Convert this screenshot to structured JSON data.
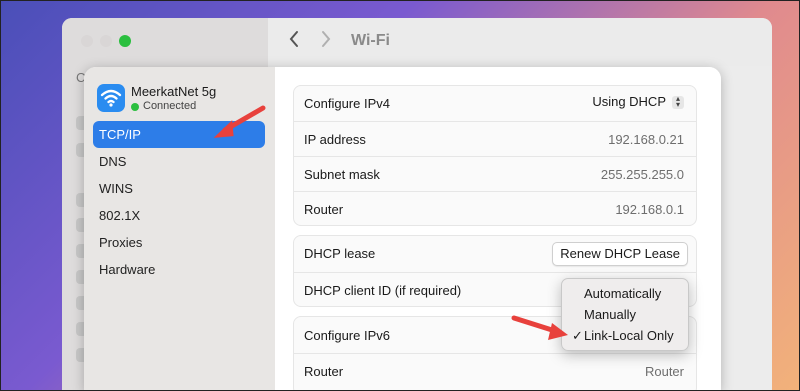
{
  "window": {
    "title": "Wi-Fi",
    "back_icon": "chevron-left-icon",
    "forward_icon": "chevron-right-icon"
  },
  "background_sidebar": {
    "partial_text": "C"
  },
  "network": {
    "name": "MeerkatNet 5g",
    "status": "Connected",
    "icon": "wifi-icon"
  },
  "sidebar": {
    "items": [
      {
        "label": "TCP/IP",
        "selected": true
      },
      {
        "label": "DNS"
      },
      {
        "label": "WINS"
      },
      {
        "label": "802.1X"
      },
      {
        "label": "Proxies"
      },
      {
        "label": "Hardware"
      }
    ]
  },
  "ipv4": {
    "configure_label": "Configure IPv4",
    "configure_value": "Using DHCP",
    "ip_label": "IP address",
    "ip_value": "192.168.0.21",
    "subnet_label": "Subnet mask",
    "subnet_value": "255.255.255.0",
    "router_label": "Router",
    "router_value": "192.168.0.1"
  },
  "dhcp": {
    "lease_label": "DHCP lease",
    "renew_button": "Renew DHCP Lease",
    "client_id_label": "DHCP client ID (if required)"
  },
  "ipv6": {
    "configure_label": "Configure IPv6",
    "router_label": "Router",
    "router_value": "Router"
  },
  "ipv6_menu": {
    "options": [
      "Automatically",
      "Manually",
      "Link-Local Only"
    ],
    "checked_mark": "✓",
    "selected": "Link-Local Only"
  },
  "colors": {
    "accent": "#2d7de8",
    "annotation_arrow": "#e8413c",
    "connected": "#2bbf3f"
  }
}
